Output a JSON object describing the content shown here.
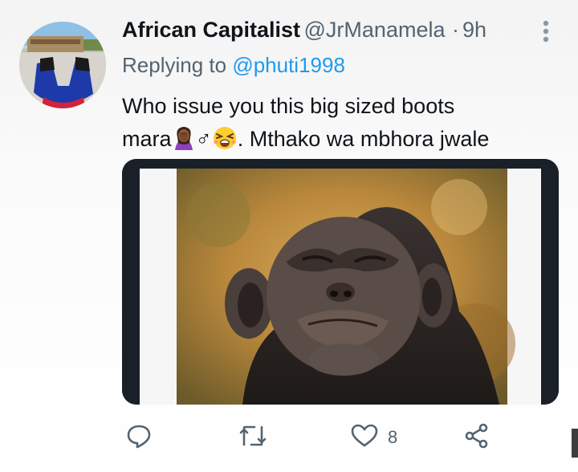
{
  "tweet": {
    "author_name": "African Capitalist",
    "handle": "@JrManamela",
    "separator": "·",
    "time": "9h",
    "replying_prefix": "Replying to",
    "replying_to": "@phuti1998",
    "text_line1": "Who issue you this big sized boots",
    "text_line2_start": "mara",
    "text_line2_symbol": "♂",
    "text_line2_end": ". Mthako wa mbhora jwale"
  },
  "actions": {
    "like_count": "8"
  },
  "icons": [
    "more-icon",
    "reply-icon",
    "retweet-icon",
    "like-icon",
    "share-icon",
    "facepalm-emoji",
    "tired-face-emoji"
  ],
  "colors": {
    "link": "#1d9bf0",
    "secondary_text": "#536471",
    "primary_text": "#0f1419",
    "media_frame": "#1a2028"
  }
}
